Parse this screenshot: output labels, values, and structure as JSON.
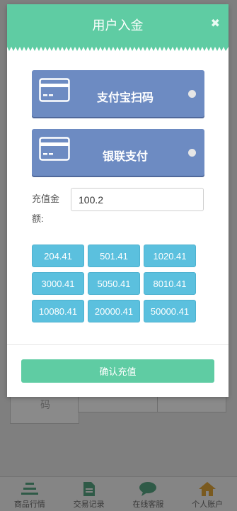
{
  "background": {
    "partial_text": "码"
  },
  "tabbar": {
    "items": [
      {
        "label": "商品行情",
        "icon": "chart-bars-icon"
      },
      {
        "label": "交易记录",
        "icon": "document-icon"
      },
      {
        "label": "在线客服",
        "icon": "chat-bubble-icon"
      },
      {
        "label": "个人账户",
        "icon": "home-icon"
      }
    ]
  },
  "modal": {
    "title": "用户入金",
    "close_symbol": "✖",
    "payment_options": [
      {
        "label": "支付宝扫码",
        "icon": "credit-card-icon"
      },
      {
        "label": "银联支付",
        "icon": "credit-card-icon"
      }
    ],
    "amount_label": "充值金额:",
    "amount_value": "100.2",
    "preset_amounts": [
      "204.41",
      "501.41",
      "1020.41",
      "3000.41",
      "5050.41",
      "8010.41",
      "10080.41",
      "20000.41",
      "50000.41"
    ],
    "confirm_label": "确认充值"
  },
  "colors": {
    "accent_green": "#5fcca3",
    "pay_blue": "#6d8bc2",
    "amount_cyan": "#5bc0de"
  }
}
